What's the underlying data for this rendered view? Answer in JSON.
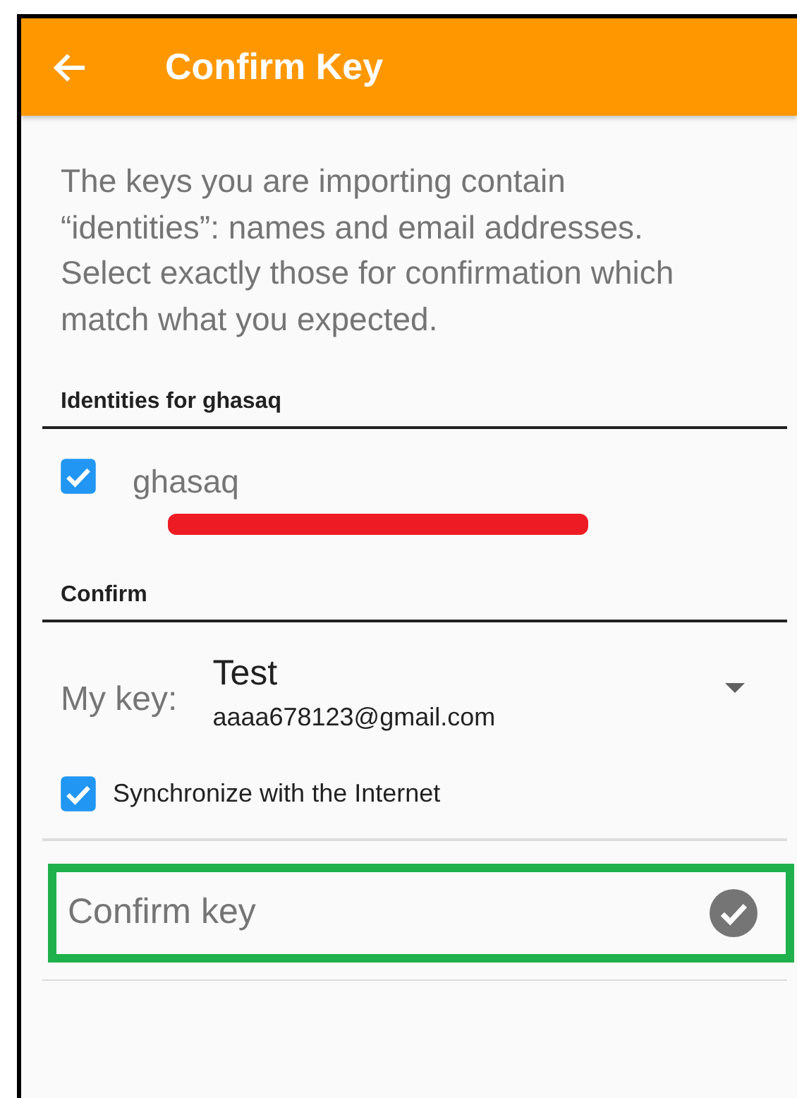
{
  "app_bar": {
    "title": "Confirm Key"
  },
  "intro": "The keys you are importing contain “identities”: names and email addresses. Select exactly those for confirmation which match what you expected.",
  "identities": {
    "title": "Identities for ghasaq",
    "items": [
      {
        "name": "ghasaq",
        "checked": true,
        "email_redacted": true
      }
    ]
  },
  "confirm": {
    "title": "Confirm",
    "my_key": {
      "label": "My key:",
      "name": "Test",
      "email": "aaaa678123@gmail.com"
    },
    "sync": {
      "label": "Synchronize with the Internet",
      "checked": true
    },
    "action": {
      "label": "Confirm key",
      "highlighted": true
    }
  }
}
